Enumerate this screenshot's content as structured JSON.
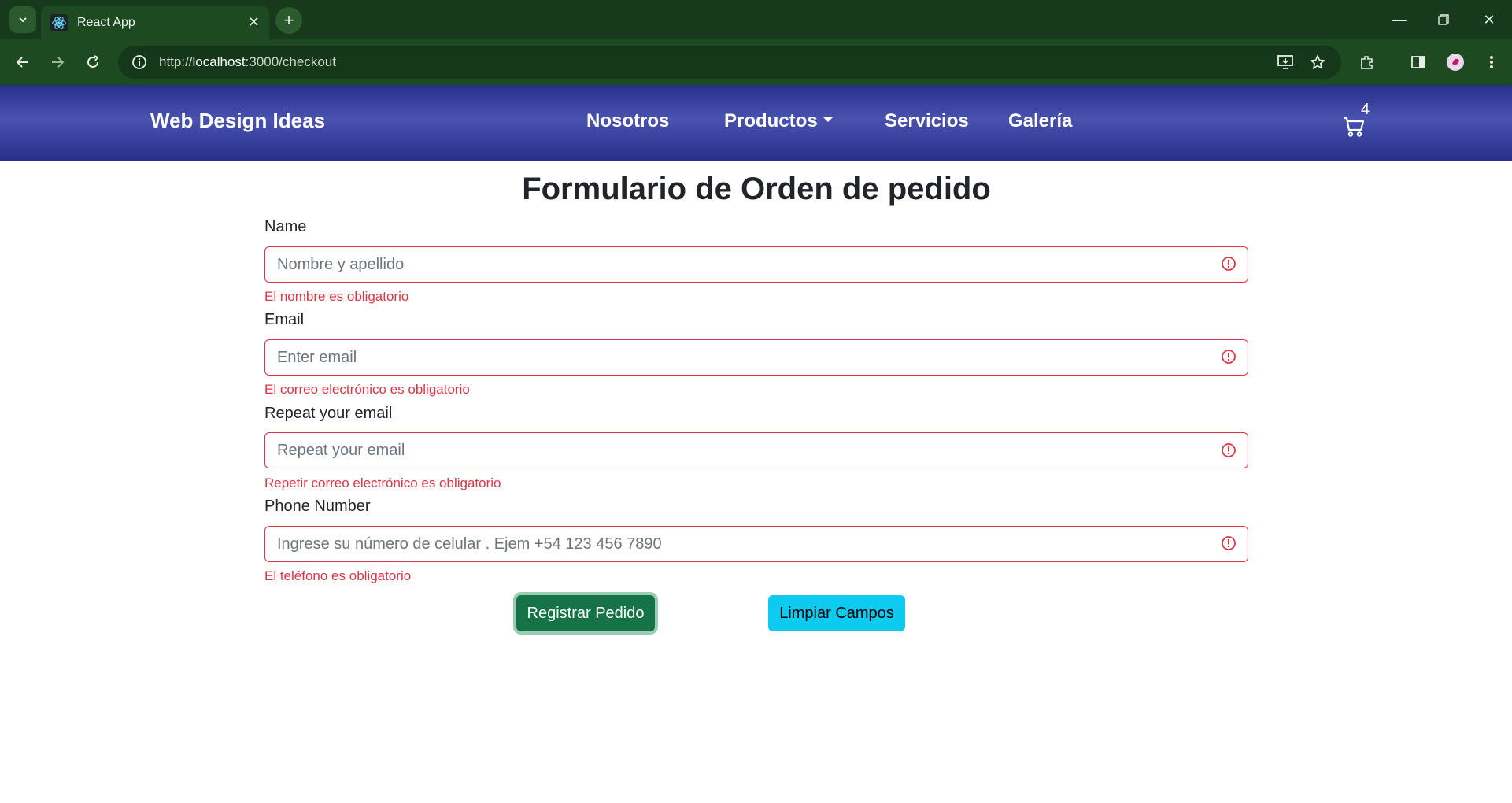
{
  "browser": {
    "tab_title": "React App",
    "url_prefix": "http://",
    "url_host": "localhost",
    "url_rest": ":3000/checkout",
    "icons": [
      "tab-search-icon",
      "react-favicon-icon",
      "close-icon",
      "plus-icon",
      "minimize-icon",
      "restore-icon",
      "close-window-icon",
      "back-icon",
      "forward-icon",
      "reload-icon",
      "site-info-icon",
      "install-app-icon",
      "star-icon",
      "extensions-icon",
      "side-panel-icon",
      "profile-avatar",
      "more-menu-icon"
    ]
  },
  "navbar": {
    "brand": "Web Design Ideas",
    "links": [
      "Nosotros",
      "Productos",
      "Servicios",
      "Galería"
    ],
    "cart_count": "4",
    "colors": {
      "background": "#2b3492"
    }
  },
  "form": {
    "title": "Formulario de Orden de pedido",
    "fields": [
      {
        "label": "Name",
        "placeholder": "Nombre y apellido",
        "error": "El nombre es obligatorio"
      },
      {
        "label": "Email",
        "placeholder": "Enter email",
        "error": "El correo electrónico es obligatorio"
      },
      {
        "label": "Repeat your email",
        "placeholder": "Repeat your email",
        "error": "Repetir correo electrónico es obligatorio"
      },
      {
        "label": "Phone Number",
        "placeholder": "Ingrese su número de celular . Ejem +54 123 456 7890",
        "error": "El teléfono es obligatorio"
      }
    ],
    "submit_label": "Registrar Pedido",
    "clear_label": "Limpiar Campos",
    "colors": {
      "error": "#dc3545",
      "submit": "#157347",
      "clear": "#0dcaf0"
    }
  }
}
